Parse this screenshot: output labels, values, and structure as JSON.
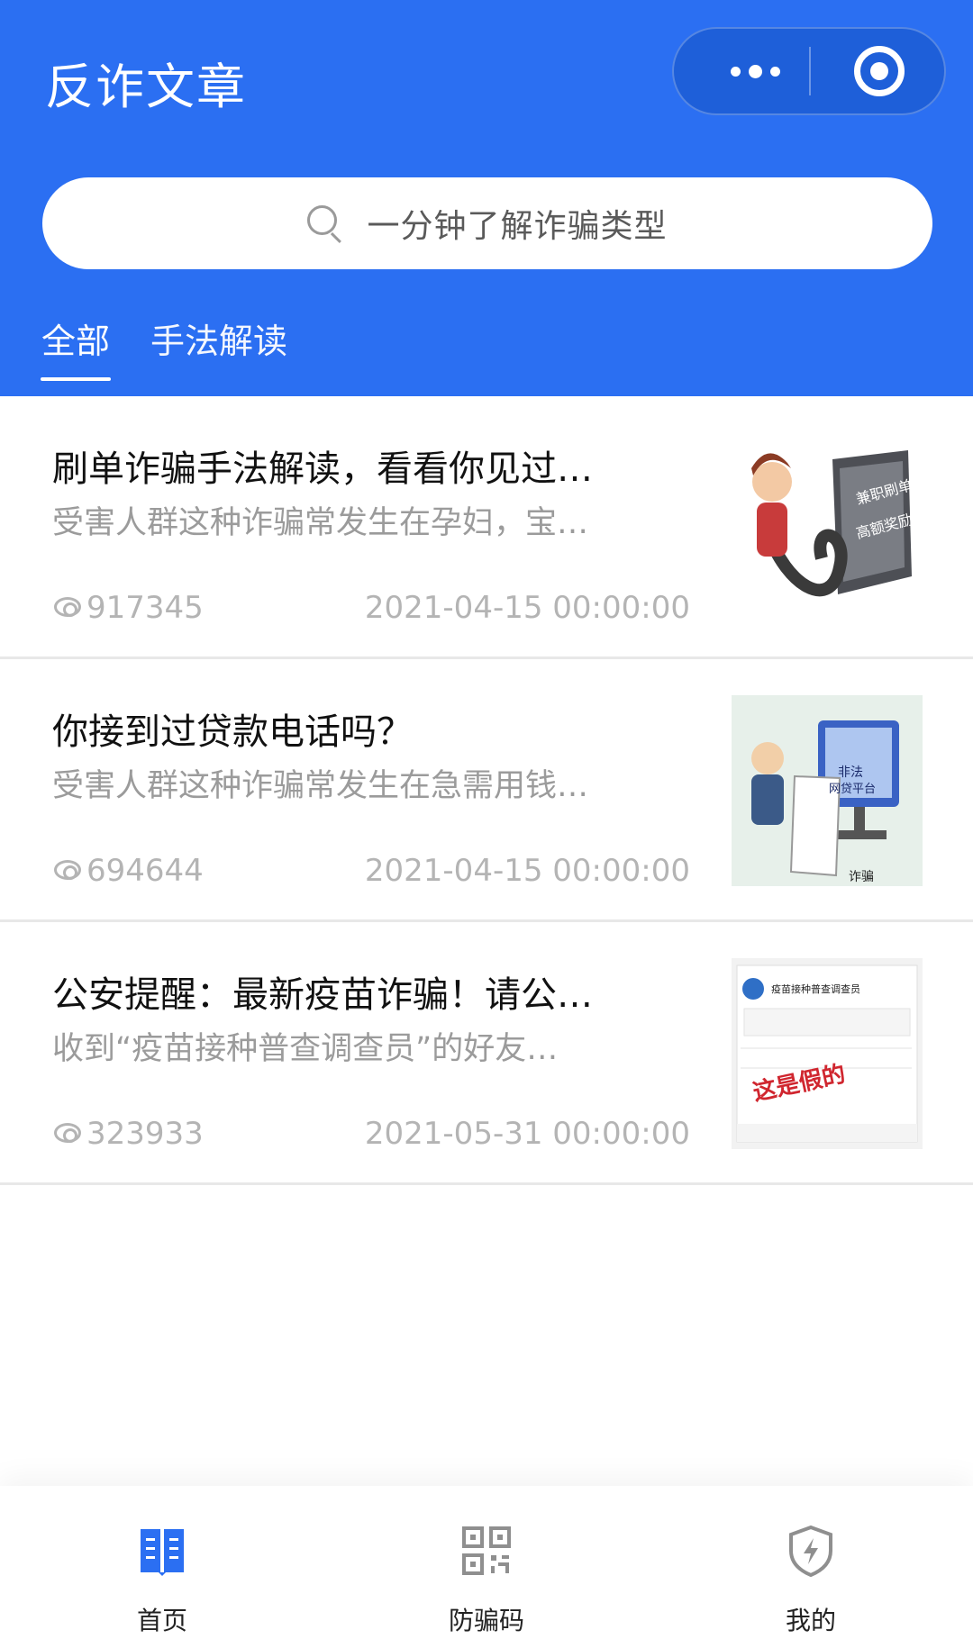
{
  "header": {
    "title": "反诈文章",
    "capsule": {
      "more_icon": "more-dots-icon",
      "close_icon": "target-icon"
    },
    "search": {
      "placeholder": "一分钟了解诈骗类型",
      "icon": "search-icon"
    },
    "tabs": [
      {
        "label": "全部",
        "active": true
      },
      {
        "label": "手法解读",
        "active": false
      }
    ]
  },
  "articles": [
    {
      "title": "刷单诈骗手法解读，看看你见过…",
      "desc": "受害人群这种诈骗常发生在孕妇，宝…",
      "views": "917345",
      "date": "2021-04-15 00:00:00",
      "thumb_labels": [
        "兼职刷单",
        "高额奖励"
      ]
    },
    {
      "title": "你接到过贷款电话吗？",
      "desc": "受害人群这种诈骗常发生在急需用钱…",
      "views": "694644",
      "date": "2021-04-15 00:00:00",
      "thumb_labels": [
        "非法",
        "网贷平台",
        "诈骗"
      ]
    },
    {
      "title": "公安提醒：最新疫苗诈骗！请公…",
      "desc": "收到“疫苗接种普查调查员”的好友…",
      "views": "323933",
      "date": "2021-05-31 00:00:00",
      "thumb_labels": [
        "疫苗接种普查调查员",
        "这是假的"
      ]
    }
  ],
  "tabbar": {
    "items": [
      {
        "label": "首页",
        "icon": "book-icon",
        "active": true
      },
      {
        "label": "防骗码",
        "icon": "qr-code-icon",
        "active": false
      },
      {
        "label": "我的",
        "icon": "shield-icon",
        "active": false
      }
    ]
  },
  "colors": {
    "primary": "#2b6ff2",
    "text_primary": "#111111",
    "text_secondary": "#9b9b9b",
    "text_meta": "#b4b4b4",
    "divider": "#e8e8e8",
    "tab_active_icon": "#2b6ff2",
    "tab_inactive_icon": "#8f8f8f"
  }
}
